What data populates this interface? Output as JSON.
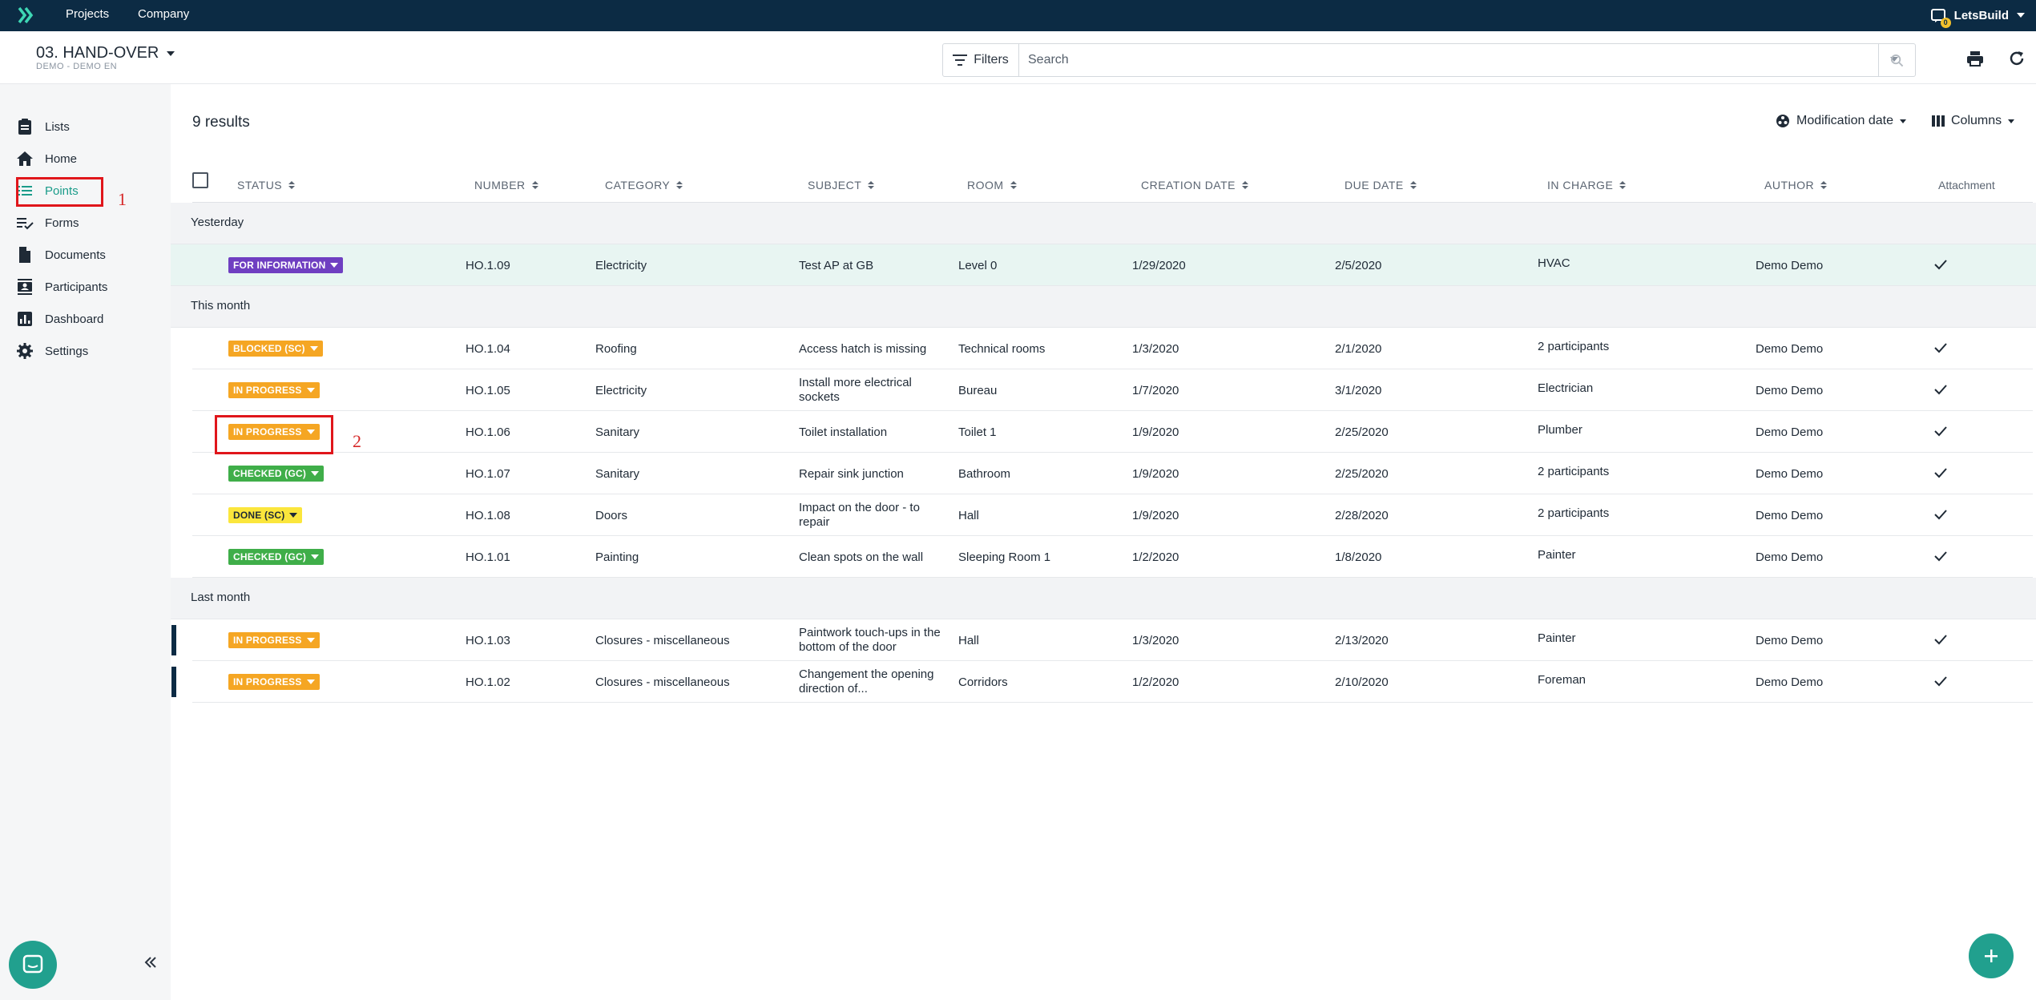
{
  "topbar": {
    "logo_icon": "letsbuild-logo-icon",
    "nav": [
      "Projects",
      "Company"
    ],
    "user_name": "LetsBuild",
    "notification_count": "0"
  },
  "header": {
    "project_title": "03. HAND-OVER",
    "project_subtitle": "DEMO - DEMO EN",
    "filters_label": "Filters",
    "search_placeholder": "Search"
  },
  "sidebar": {
    "items": [
      {
        "label": "Lists",
        "icon": "clipboard-icon"
      },
      {
        "label": "Home",
        "icon": "home-icon"
      },
      {
        "label": "Points",
        "icon": "list-icon",
        "active": true
      },
      {
        "label": "Forms",
        "icon": "checklist-icon"
      },
      {
        "label": "Documents",
        "icon": "document-icon"
      },
      {
        "label": "Participants",
        "icon": "contacts-icon"
      },
      {
        "label": "Dashboard",
        "icon": "chart-icon"
      },
      {
        "label": "Settings",
        "icon": "gear-icon"
      }
    ]
  },
  "annotations": [
    "1",
    "2"
  ],
  "main": {
    "results_label": "9 results",
    "sort_label": "Modification date",
    "columns_label": "Columns",
    "columns": [
      "STATUS",
      "NUMBER",
      "CATEGORY",
      "SUBJECT",
      "ROOM",
      "CREATION DATE",
      "DUE DATE",
      "IN CHARGE",
      "AUTHOR",
      "Attachment"
    ],
    "groups": [
      {
        "label": "Yesterday",
        "rows": [
          {
            "status": "FOR INFORMATION",
            "status_color": "#6f3fc1",
            "number": "HO.1.09",
            "category": "Electricity",
            "subject": "Test AP at GB",
            "room": "Level 0",
            "creation_date": "1/29/2020",
            "due_date": "2/5/2020",
            "in_charge": "HVAC",
            "author": "Demo Demo",
            "attachment": true
          }
        ]
      },
      {
        "label": "This month",
        "rows": [
          {
            "status": "BLOCKED (SC)",
            "status_color": "#f5a623",
            "number": "HO.1.04",
            "category": "Roofing",
            "subject": "Access hatch is missing",
            "room": "Technical rooms",
            "creation_date": "1/3/2020",
            "due_date": "2/1/2020",
            "in_charge": "2 participants",
            "author": "Demo Demo",
            "attachment": true
          },
          {
            "status": "IN PROGRESS",
            "status_color": "#f5a623",
            "number": "HO.1.05",
            "category": "Electricity",
            "subject": "Install more electrical sockets",
            "room": "Bureau",
            "creation_date": "1/7/2020",
            "due_date": "3/1/2020",
            "in_charge": "Electrician",
            "author": "Demo Demo",
            "attachment": true
          },
          {
            "status": "IN PROGRESS",
            "status_color": "#f5a623",
            "number": "HO.1.06",
            "category": "Sanitary",
            "subject": "Toilet installation",
            "room": "Toilet 1",
            "creation_date": "1/9/2020",
            "due_date": "2/25/2020",
            "in_charge": "Plumber",
            "author": "Demo Demo",
            "attachment": true
          },
          {
            "status": "CHECKED (GC)",
            "status_color": "#3fae49",
            "number": "HO.1.07",
            "category": "Sanitary",
            "subject": "Repair sink junction",
            "room": "Bathroom",
            "creation_date": "1/9/2020",
            "due_date": "2/25/2020",
            "in_charge": "2 participants",
            "author": "Demo Demo",
            "attachment": true
          },
          {
            "status": "DONE (SC)",
            "status_color": "#fbe63c",
            "number": "HO.1.08",
            "category": "Doors",
            "subject": "Impact on the door - to repair",
            "room": "Hall",
            "creation_date": "1/9/2020",
            "due_date": "2/28/2020",
            "in_charge": "2 participants",
            "author": "Demo Demo",
            "attachment": true
          },
          {
            "status": "CHECKED (GC)",
            "status_color": "#3fae49",
            "number": "HO.1.01",
            "category": "Painting",
            "subject": "Clean spots on the wall",
            "room": "Sleeping Room 1",
            "creation_date": "1/2/2020",
            "due_date": "1/8/2020",
            "in_charge": "Painter",
            "author": "Demo Demo",
            "attachment": true
          }
        ]
      },
      {
        "label": "Last month",
        "rows": [
          {
            "status": "IN PROGRESS",
            "status_color": "#f5a623",
            "number": "HO.1.03",
            "category": "Closures - miscellaneous",
            "subject": "Paintwork touch-ups in the bottom of the door",
            "room": "Hall",
            "creation_date": "1/3/2020",
            "due_date": "2/13/2020",
            "in_charge": "Painter",
            "author": "Demo Demo",
            "attachment": true
          },
          {
            "status": "IN PROGRESS",
            "status_color": "#f5a623",
            "number": "HO.1.02",
            "category": "Closures - miscellaneous",
            "subject": "Changement the opening direction of...",
            "room": "Corridors",
            "creation_date": "1/2/2020",
            "due_date": "2/10/2020",
            "in_charge": "Foreman",
            "author": "Demo Demo",
            "attachment": true
          }
        ]
      }
    ]
  },
  "colors": {
    "topbar": "#0c2b44",
    "accent": "#21a08e",
    "annotation": "#e0161b"
  }
}
